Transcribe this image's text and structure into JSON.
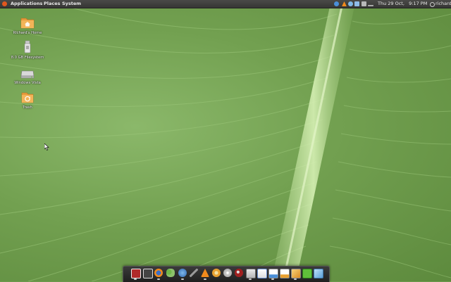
{
  "top_panel": {
    "menus": [
      "Applications",
      "Places",
      "System"
    ],
    "clock": "Thu 29 Oct,   9:17 PM",
    "user": "richard"
  },
  "desktop_icons": [
    {
      "label": "Richard's Home",
      "icon": "home-folder-icon"
    },
    {
      "label": "8.0 GB Filesystem",
      "icon": "usb-drive-icon"
    },
    {
      "label": "Windows Vista",
      "icon": "hard-drive-icon"
    },
    {
      "label": "Trash",
      "icon": "trash-icon"
    }
  ],
  "dock_items": [
    "terminal-icon",
    "workspace-switcher-icon",
    "firefox-icon",
    "pidgin-icon",
    "blue-globe-icon",
    "wrench-tool-icon",
    "vlc-icon",
    "rhythmbox-icon",
    "disc-burner-icon",
    "gimp-icon",
    "files-icon",
    "document-editor-icon",
    "spreadsheet-icon",
    "presentation-icon",
    "drawing-icon",
    "checkbox-app-icon",
    "archive-box-icon"
  ],
  "colors": {
    "panel": "#3f3f3d",
    "wallpaper_green": "#72a050",
    "ubuntu_orange": "#e2571e"
  }
}
